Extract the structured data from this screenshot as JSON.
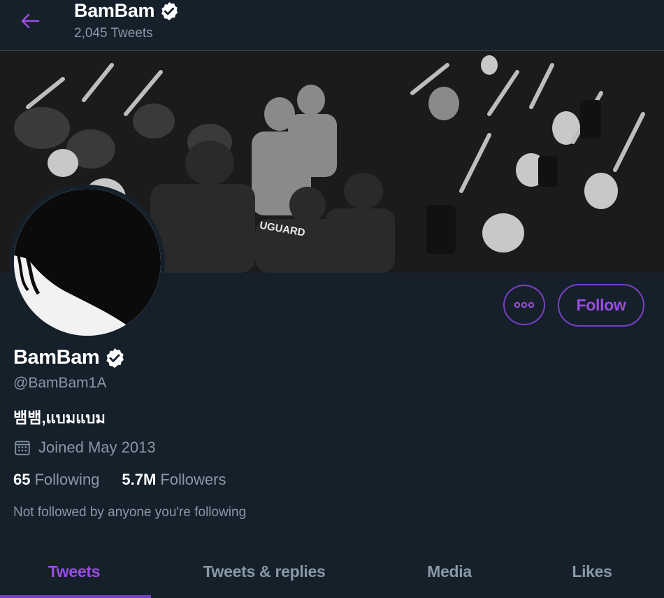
{
  "header": {
    "name": "BamBam",
    "tweet_count": "2,045 Tweets"
  },
  "profile": {
    "name": "BamBam",
    "handle": "@BamBam1A",
    "bio": "뱀뱀,แบมแบม",
    "joined": "Joined May 2013",
    "following_count": "65",
    "following_label": "Following",
    "followers_count": "5.7M",
    "followers_label": "Followers",
    "not_followed": "Not followed by anyone you're following"
  },
  "actions": {
    "follow_label": "Follow"
  },
  "tabs": [
    {
      "label": "Tweets",
      "active": true
    },
    {
      "label": "Tweets & replies",
      "active": false
    },
    {
      "label": "Media",
      "active": false
    },
    {
      "label": "Likes",
      "active": false
    }
  ],
  "colors": {
    "background": "#15202b",
    "accent": "#7b3fc4",
    "muted_text": "#8899a6"
  },
  "icons": {
    "back": "back-arrow-icon",
    "verified": "verified-badge-icon",
    "more": "more-horizontal-icon",
    "calendar": "calendar-icon"
  }
}
